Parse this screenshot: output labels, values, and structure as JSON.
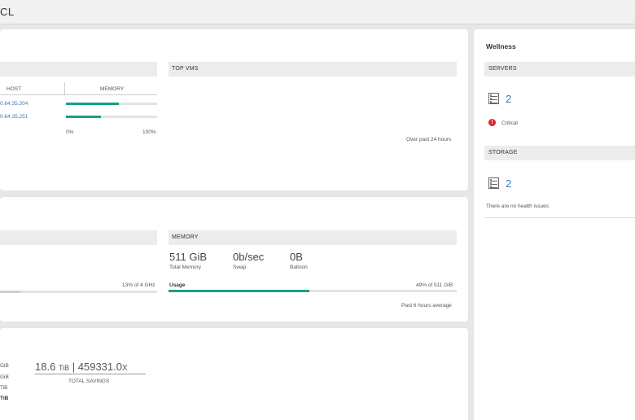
{
  "app": {
    "title": "CL"
  },
  "top_panel": {
    "hosts_table": {
      "col_host": "HOST",
      "col_memory": "MEMORY",
      "rows": [
        {
          "host": "0.64.35.204",
          "memory_fraction": 0.58
        },
        {
          "host": "0.64.35.251",
          "memory_fraction": 0.38
        }
      ],
      "axis_min": "0%",
      "axis_max": "100%"
    },
    "top_vms": {
      "header": "TOP VMS",
      "footnote": "Over past 24 hours"
    }
  },
  "mid_panel": {
    "cpu": {
      "usage_text": "13% of 4 GHz",
      "fraction": 0.13
    },
    "memory": {
      "header": "MEMORY",
      "stats": [
        {
          "value": "511 GiB",
          "label": "Total Memory"
        },
        {
          "value": "0b/sec",
          "label": "Swap"
        },
        {
          "value": "0B",
          "label": "Balloon"
        }
      ],
      "usage_label": "Usage",
      "usage_text": "49% of 511 GiB",
      "usage_fraction": 0.49,
      "footnote": "Past 6 hours average"
    }
  },
  "bottom_panel": {
    "left_values": [
      "GiB",
      "GiB",
      "TiB",
      "TiB"
    ],
    "savings_tib": "18.6",
    "savings_tib_unit": "TiB",
    "savings_ratio": "459331.0",
    "savings_ratio_unit": "X",
    "savings_label": "TOTAL SAVINGS"
  },
  "wellness": {
    "title": "Wellness",
    "servers": {
      "header": "SERVERS",
      "count": "2",
      "status": "Critical"
    },
    "storage": {
      "header": "STORAGE",
      "count": "2",
      "status": "There are no health issues"
    }
  },
  "colors": {
    "accent": "#1a9f86",
    "link": "#3b78b8",
    "critical": "#d9262a"
  }
}
